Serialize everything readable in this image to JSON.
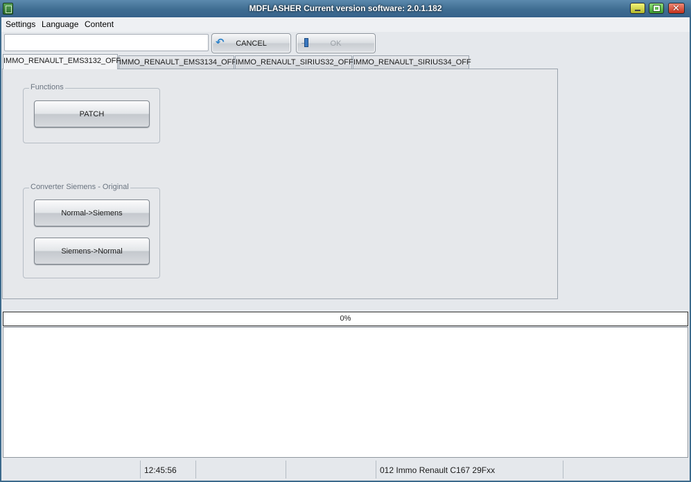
{
  "window": {
    "title": "MDFLASHER  Current version software: 2.0.1.182",
    "close_glyph": "✕"
  },
  "menu": {
    "items": [
      "Settings",
      "Language",
      "Content"
    ]
  },
  "toolbar": {
    "input_value": "",
    "cancel_label": "CANCEL",
    "ok_label": "OK",
    "undo_glyph": "↶"
  },
  "tabs": [
    {
      "label": "IMMO_RENAULT_EMS3132_OFF",
      "active": true
    },
    {
      "label": "IMMO_RENAULT_EMS3134_OFF",
      "active": false
    },
    {
      "label": "IMMO_RENAULT_SIRIUS32_OFF",
      "active": false
    },
    {
      "label": "IMMO_RENAULT_SIRIUS34_OFF",
      "active": false
    }
  ],
  "panel": {
    "functions": {
      "title": "Functions",
      "buttons": [
        "PATCH"
      ]
    },
    "converter": {
      "title": "Converter Siemens - Original",
      "buttons": [
        "Normal->Siemens",
        "Siemens->Normal"
      ]
    }
  },
  "progress": {
    "value": 0,
    "label": "0%"
  },
  "log": {
    "lines": []
  },
  "statusbar": {
    "time": "12:45:56",
    "device": "012 Immo Renault C167 29Fxx"
  },
  "colors": {
    "titlebar": "#3f6d92",
    "client_bg": "#e5e8ec",
    "link_icon": "#2d82c9"
  }
}
